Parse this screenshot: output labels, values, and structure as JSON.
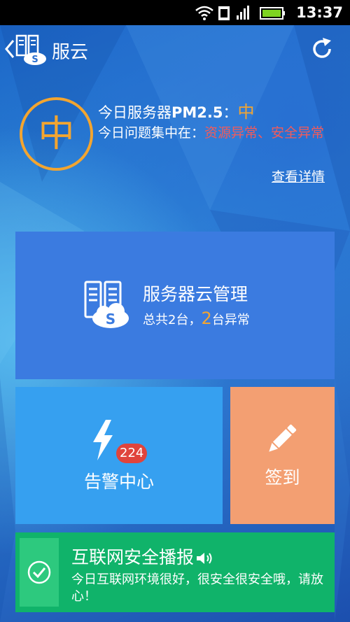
{
  "status_bar": {
    "time": "13:37",
    "icons": [
      "wifi-icon",
      "sim-icon",
      "signal-icon",
      "battery-icon"
    ]
  },
  "header": {
    "title": "服云"
  },
  "summary": {
    "gauge_level": "中",
    "pm_prefix": "今日服务器",
    "pm_label": "PM2.5",
    "pm_separator": "：",
    "pm_value": "中",
    "issue_prefix": "今日问题集中在：",
    "issue_text": "资源异常、安全异常",
    "detail_link": "查看详情"
  },
  "tiles": {
    "server": {
      "title": "服务器云管理",
      "sub_prefix": "总共2台，",
      "abnormal_count": "2",
      "sub_suffix": "台异常"
    },
    "alarm": {
      "title": "告警中心",
      "badge": "224"
    },
    "signin": {
      "title": "签到"
    },
    "news": {
      "title": "互联网安全播报",
      "body": "今日互联网环境很好，很安全很安全哦，请放心！"
    }
  },
  "colors": {
    "accent_orange": "#f3a530",
    "warning_red": "#f25b5b",
    "tile_server": "#3b7be0",
    "tile_alarm": "#36a0f0",
    "tile_signin": "#f39f72",
    "tile_news": "#10b36a"
  }
}
